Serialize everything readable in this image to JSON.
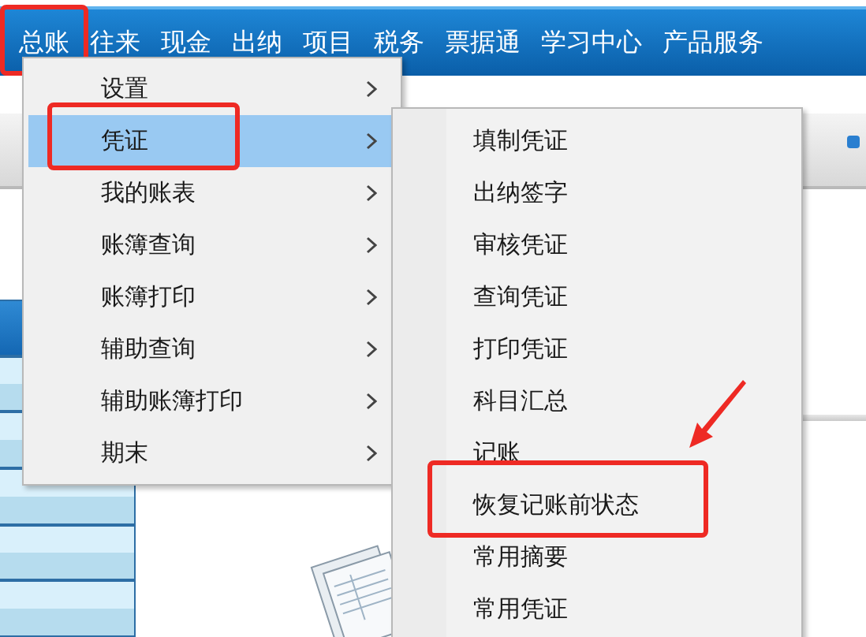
{
  "menubar": [
    {
      "label": "总账",
      "annotated": true
    },
    {
      "label": "往来",
      "annotated": false
    },
    {
      "label": "现金",
      "annotated": false
    },
    {
      "label": "出纳",
      "annotated": false
    },
    {
      "label": "项目",
      "annotated": false
    },
    {
      "label": "税务",
      "annotated": false
    },
    {
      "label": "票据通",
      "annotated": false
    },
    {
      "label": "学习中心",
      "annotated": false
    },
    {
      "label": "产品服务",
      "annotated": false
    }
  ],
  "menu": {
    "items": [
      {
        "label": "设置",
        "selected": false,
        "annotated": false
      },
      {
        "label": "凭证",
        "selected": true,
        "annotated": true
      },
      {
        "label": "我的账表",
        "selected": false,
        "annotated": false
      },
      {
        "label": "账簿查询",
        "selected": false,
        "annotated": false
      },
      {
        "label": "账簿打印",
        "selected": false,
        "annotated": false
      },
      {
        "label": "辅助查询",
        "selected": false,
        "annotated": false
      },
      {
        "label": "辅助账簿打印",
        "selected": false,
        "annotated": false
      },
      {
        "label": "期末",
        "selected": false,
        "annotated": false
      }
    ]
  },
  "submenu": {
    "items": [
      {
        "label": "填制凭证",
        "annotated": false
      },
      {
        "label": "出纳签字",
        "annotated": false
      },
      {
        "label": "审核凭证",
        "annotated": false
      },
      {
        "label": "查询凭证",
        "annotated": false
      },
      {
        "label": "打印凭证",
        "annotated": false
      },
      {
        "label": "科目汇总",
        "annotated": false
      },
      {
        "label": "记账",
        "annotated": false
      },
      {
        "label": "恢复记账前状态",
        "annotated": true
      },
      {
        "label": "常用摘要",
        "annotated": false
      },
      {
        "label": "常用凭证",
        "annotated": false
      }
    ]
  },
  "annotations": [
    {
      "kind": "arrow"
    }
  ],
  "sidebar": {
    "tabs": [
      {
        "selected": true
      },
      {
        "selected": false
      },
      {
        "selected": false
      },
      {
        "selected": false
      },
      {
        "selected": false
      },
      {
        "selected": false
      }
    ]
  }
}
